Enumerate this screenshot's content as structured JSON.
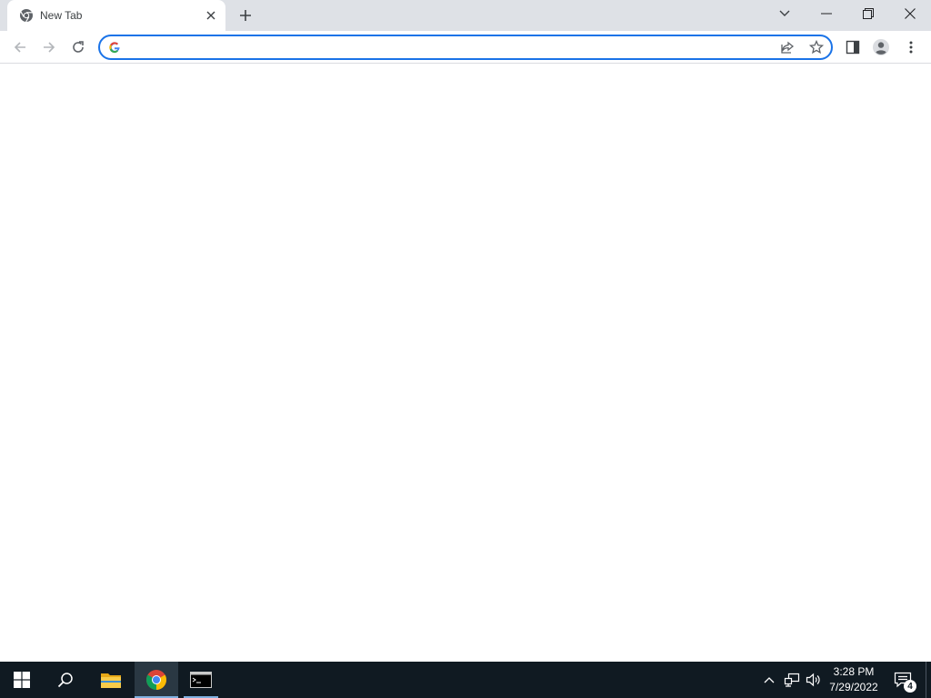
{
  "browser": {
    "tab": {
      "title": "New Tab",
      "favicon": "chrome-icon"
    },
    "omnibox": {
      "value": "",
      "placeholder": ""
    },
    "colors": {
      "tabstrip": "#dee1e6",
      "focus_ring": "#1a73e8",
      "icon": "#5f6368"
    }
  },
  "taskbar": {
    "apps": [
      "windows-start-icon",
      "search-icon",
      "file-explorer-icon",
      "chrome-icon",
      "command-prompt-icon"
    ],
    "clock": {
      "time": "3:28 PM",
      "date": "7/29/2022"
    },
    "notifications": {
      "count": "4"
    },
    "colors": {
      "background": "#101a22",
      "active_indicator": "#7fb0e0"
    }
  }
}
